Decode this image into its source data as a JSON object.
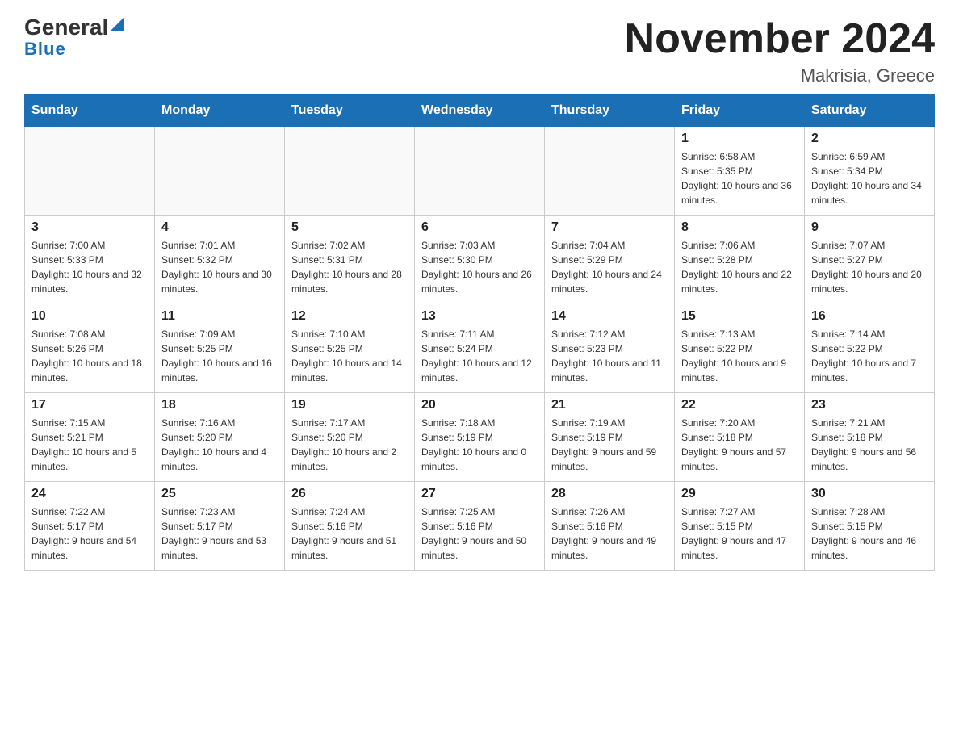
{
  "header": {
    "logo_general": "General",
    "logo_blue": "Blue",
    "month_title": "November 2024",
    "location": "Makrisia, Greece"
  },
  "days_of_week": [
    "Sunday",
    "Monday",
    "Tuesday",
    "Wednesday",
    "Thursday",
    "Friday",
    "Saturday"
  ],
  "weeks": [
    [
      {
        "day": "",
        "info": ""
      },
      {
        "day": "",
        "info": ""
      },
      {
        "day": "",
        "info": ""
      },
      {
        "day": "",
        "info": ""
      },
      {
        "day": "",
        "info": ""
      },
      {
        "day": "1",
        "info": "Sunrise: 6:58 AM\nSunset: 5:35 PM\nDaylight: 10 hours and 36 minutes."
      },
      {
        "day": "2",
        "info": "Sunrise: 6:59 AM\nSunset: 5:34 PM\nDaylight: 10 hours and 34 minutes."
      }
    ],
    [
      {
        "day": "3",
        "info": "Sunrise: 7:00 AM\nSunset: 5:33 PM\nDaylight: 10 hours and 32 minutes."
      },
      {
        "day": "4",
        "info": "Sunrise: 7:01 AM\nSunset: 5:32 PM\nDaylight: 10 hours and 30 minutes."
      },
      {
        "day": "5",
        "info": "Sunrise: 7:02 AM\nSunset: 5:31 PM\nDaylight: 10 hours and 28 minutes."
      },
      {
        "day": "6",
        "info": "Sunrise: 7:03 AM\nSunset: 5:30 PM\nDaylight: 10 hours and 26 minutes."
      },
      {
        "day": "7",
        "info": "Sunrise: 7:04 AM\nSunset: 5:29 PM\nDaylight: 10 hours and 24 minutes."
      },
      {
        "day": "8",
        "info": "Sunrise: 7:06 AM\nSunset: 5:28 PM\nDaylight: 10 hours and 22 minutes."
      },
      {
        "day": "9",
        "info": "Sunrise: 7:07 AM\nSunset: 5:27 PM\nDaylight: 10 hours and 20 minutes."
      }
    ],
    [
      {
        "day": "10",
        "info": "Sunrise: 7:08 AM\nSunset: 5:26 PM\nDaylight: 10 hours and 18 minutes."
      },
      {
        "day": "11",
        "info": "Sunrise: 7:09 AM\nSunset: 5:25 PM\nDaylight: 10 hours and 16 minutes."
      },
      {
        "day": "12",
        "info": "Sunrise: 7:10 AM\nSunset: 5:25 PM\nDaylight: 10 hours and 14 minutes."
      },
      {
        "day": "13",
        "info": "Sunrise: 7:11 AM\nSunset: 5:24 PM\nDaylight: 10 hours and 12 minutes."
      },
      {
        "day": "14",
        "info": "Sunrise: 7:12 AM\nSunset: 5:23 PM\nDaylight: 10 hours and 11 minutes."
      },
      {
        "day": "15",
        "info": "Sunrise: 7:13 AM\nSunset: 5:22 PM\nDaylight: 10 hours and 9 minutes."
      },
      {
        "day": "16",
        "info": "Sunrise: 7:14 AM\nSunset: 5:22 PM\nDaylight: 10 hours and 7 minutes."
      }
    ],
    [
      {
        "day": "17",
        "info": "Sunrise: 7:15 AM\nSunset: 5:21 PM\nDaylight: 10 hours and 5 minutes."
      },
      {
        "day": "18",
        "info": "Sunrise: 7:16 AM\nSunset: 5:20 PM\nDaylight: 10 hours and 4 minutes."
      },
      {
        "day": "19",
        "info": "Sunrise: 7:17 AM\nSunset: 5:20 PM\nDaylight: 10 hours and 2 minutes."
      },
      {
        "day": "20",
        "info": "Sunrise: 7:18 AM\nSunset: 5:19 PM\nDaylight: 10 hours and 0 minutes."
      },
      {
        "day": "21",
        "info": "Sunrise: 7:19 AM\nSunset: 5:19 PM\nDaylight: 9 hours and 59 minutes."
      },
      {
        "day": "22",
        "info": "Sunrise: 7:20 AM\nSunset: 5:18 PM\nDaylight: 9 hours and 57 minutes."
      },
      {
        "day": "23",
        "info": "Sunrise: 7:21 AM\nSunset: 5:18 PM\nDaylight: 9 hours and 56 minutes."
      }
    ],
    [
      {
        "day": "24",
        "info": "Sunrise: 7:22 AM\nSunset: 5:17 PM\nDaylight: 9 hours and 54 minutes."
      },
      {
        "day": "25",
        "info": "Sunrise: 7:23 AM\nSunset: 5:17 PM\nDaylight: 9 hours and 53 minutes."
      },
      {
        "day": "26",
        "info": "Sunrise: 7:24 AM\nSunset: 5:16 PM\nDaylight: 9 hours and 51 minutes."
      },
      {
        "day": "27",
        "info": "Sunrise: 7:25 AM\nSunset: 5:16 PM\nDaylight: 9 hours and 50 minutes."
      },
      {
        "day": "28",
        "info": "Sunrise: 7:26 AM\nSunset: 5:16 PM\nDaylight: 9 hours and 49 minutes."
      },
      {
        "day": "29",
        "info": "Sunrise: 7:27 AM\nSunset: 5:15 PM\nDaylight: 9 hours and 47 minutes."
      },
      {
        "day": "30",
        "info": "Sunrise: 7:28 AM\nSunset: 5:15 PM\nDaylight: 9 hours and 46 minutes."
      }
    ]
  ],
  "colors": {
    "header_bg": "#1a6fb5",
    "header_text": "#ffffff",
    "border": "#cccccc",
    "day_number": "#222222",
    "day_info": "#333333"
  }
}
